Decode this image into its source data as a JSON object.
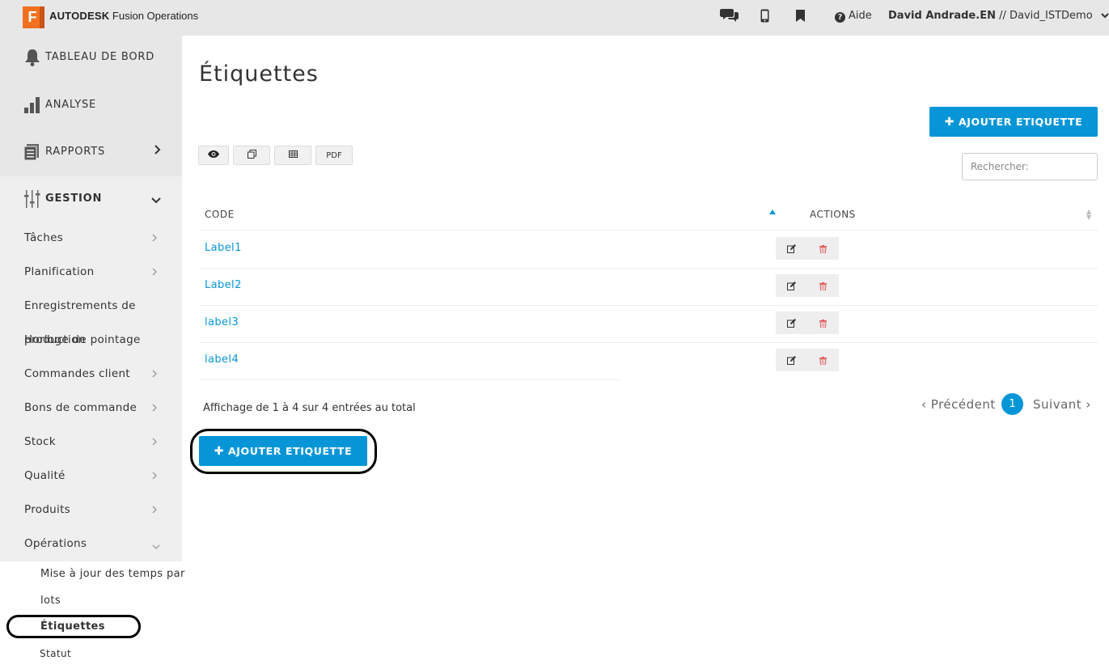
{
  "topbar": {
    "logo_letter": "F",
    "brand_bold": "AUTODESK",
    "brand_rest": " Fusion Operations",
    "help_label": "Aide",
    "user_name": "David Andrade.EN",
    "user_separator": " // ",
    "workspace": "David_ISTDemo",
    "icons": [
      "chat-icon",
      "mobile-icon",
      "bookmark-icon",
      "help-icon",
      "chevron-down-icon"
    ]
  },
  "sidebar": {
    "main": [
      {
        "label": "TABLEAU DE BORD",
        "icon": "bell-icon"
      },
      {
        "label": "ANALYSE",
        "icon": "bar-chart-icon"
      },
      {
        "label": "RAPPORTS",
        "icon": "report-icon"
      },
      {
        "label": "GESTION",
        "icon": "sliders-icon"
      }
    ],
    "items": [
      {
        "label": "Tâches"
      },
      {
        "label": "Planification"
      },
      {
        "label": "Enregistrements de"
      },
      {
        "label": "production"
      },
      {
        "label": "Horloge de pointage"
      },
      {
        "label": "Commandes client"
      },
      {
        "label": "Bons de commande"
      },
      {
        "label": "Stock"
      },
      {
        "label": "Qualité"
      },
      {
        "label": "Produits"
      },
      {
        "label": "Opérations"
      }
    ],
    "sub_items": [
      {
        "label": "Mise à jour des temps par"
      },
      {
        "label": "lots"
      },
      {
        "label": "Étiquettes"
      },
      {
        "label": "Statut"
      }
    ]
  },
  "main": {
    "title": "Étiquettes",
    "add_button_label": "AJOUTER ETIQUETTE",
    "toolbar": {
      "pdf_label": "PDF"
    },
    "search_placeholder": "Rechercher:",
    "table": {
      "headers": {
        "code": "CODE",
        "actions": "ACTIONS"
      },
      "rows": [
        {
          "code": "Label1"
        },
        {
          "code": "Label2"
        },
        {
          "code": "label3"
        },
        {
          "code": "label4"
        }
      ]
    },
    "info_text": "Affichage de 1 à 4 sur 4 entrées au total",
    "pagination": {
      "prev": "Précédent",
      "current": "1",
      "next": "Suivant"
    }
  },
  "colors": {
    "accent": "#0696d7",
    "logo": "#f37021",
    "delete": "#e05a5a"
  }
}
